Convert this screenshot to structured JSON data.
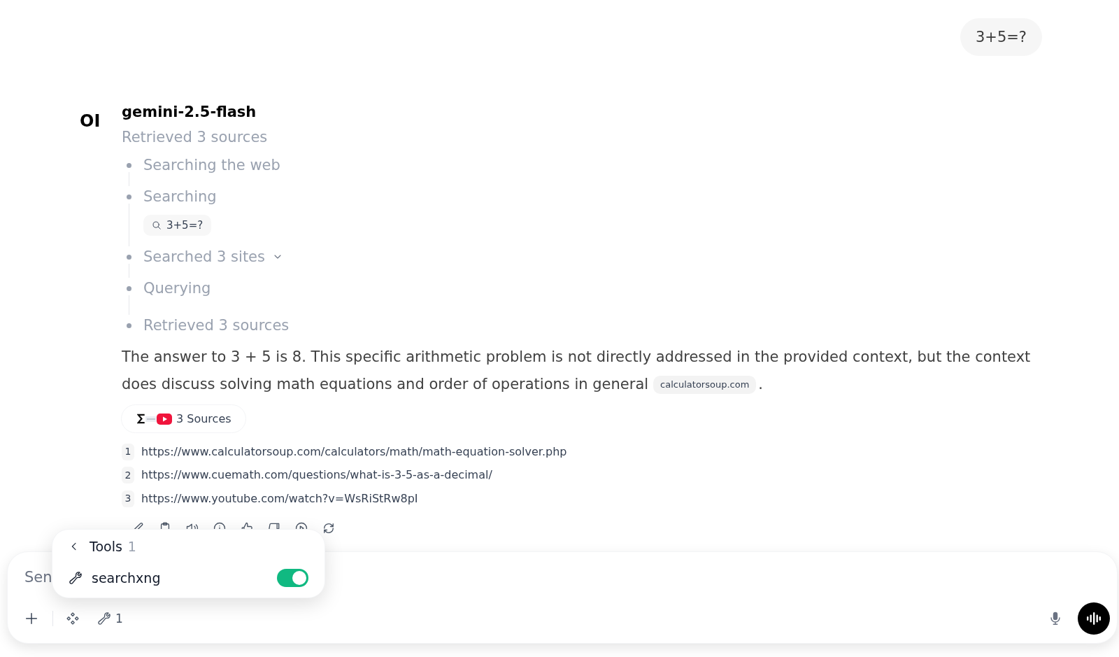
{
  "user_message": "3+5=?",
  "response": {
    "logo": "OI",
    "model": "gemini-2.5-flash",
    "status": "Retrieved 3 sources",
    "steps": [
      {
        "kind": "plain",
        "label": "Searching the web"
      },
      {
        "kind": "query",
        "label": "Searching",
        "queries": [
          "3+5=?"
        ]
      },
      {
        "kind": "collapsible",
        "label": "Searched 3 sites",
        "expanded": false
      },
      {
        "kind": "plain",
        "label": "Querying"
      },
      {
        "kind": "plain",
        "label": "Retrieved 3 sources"
      }
    ],
    "answer": [
      {
        "kind": "text",
        "text": "The answer to 3 + 5 is 8. This specific arithmetic problem is not directly addressed in the provided context, but the context does discuss solving math equations and order of operations in general"
      },
      {
        "kind": "citation",
        "text": "calculatorsoup.com"
      },
      {
        "kind": "text",
        "text": "."
      }
    ],
    "sources_button": "3 Sources",
    "sources": [
      {
        "number": "1",
        "url": "https://www.calculatorsoup.com/calculators/math/math-equation-solver.php"
      },
      {
        "number": "2",
        "url": "https://www.cuemath.com/questions/what-is-3-5-as-a-decimal/"
      },
      {
        "number": "3",
        "url": "https://www.youtube.com/watch?v=WsRiStRw8pI"
      }
    ]
  },
  "composer": {
    "placeholder": "Sen",
    "tools_count": "1"
  },
  "tools_menu": {
    "title": "Tools",
    "count": "1",
    "items": [
      {
        "name": "searchxng",
        "on": true
      }
    ]
  }
}
